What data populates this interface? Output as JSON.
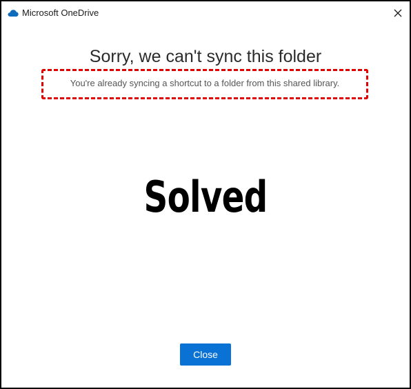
{
  "window": {
    "app_title": "Microsoft OneDrive",
    "app_icon": "onedrive-cloud-icon",
    "close_icon": "close-icon"
  },
  "dialog": {
    "heading": "Sorry, we can't sync this folder",
    "message": "You're already syncing a shortcut to a folder from this shared library.",
    "overlay_text": "Solved",
    "close_button_label": "Close"
  },
  "colors": {
    "accent": "#0a72d4",
    "highlight_border": "#e00000",
    "onedrive_blue": "#0f6cbd"
  }
}
